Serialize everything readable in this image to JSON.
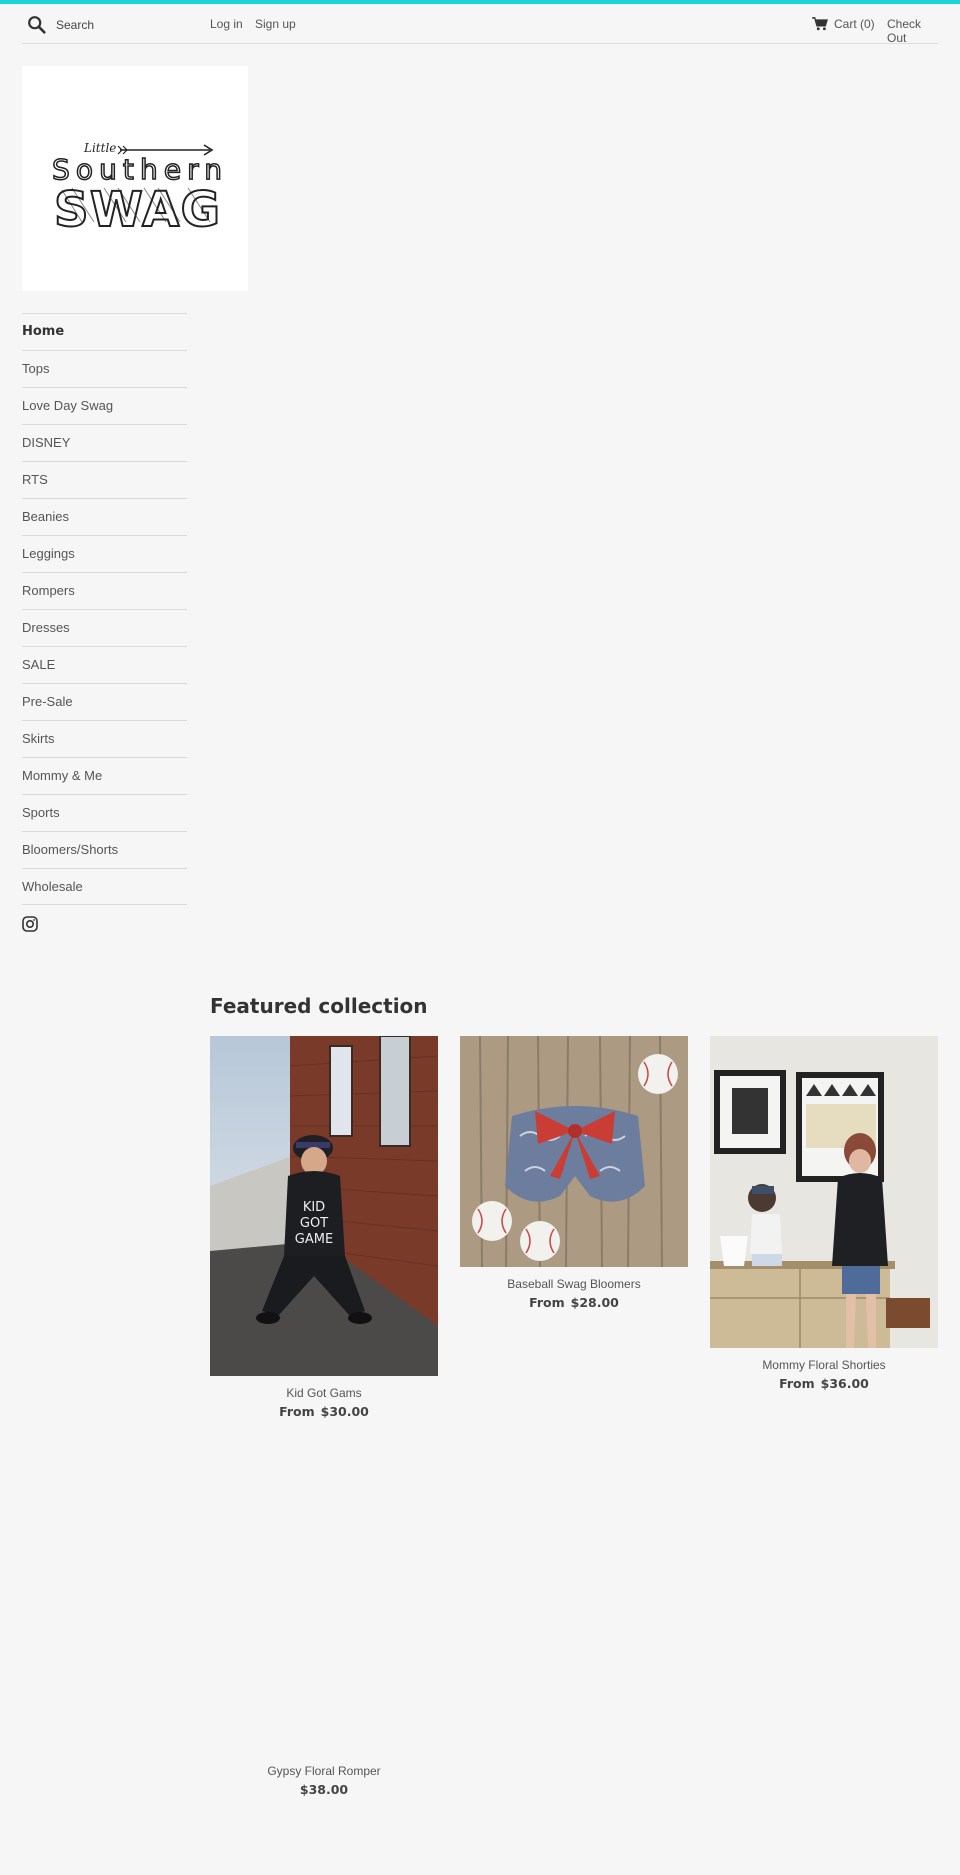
{
  "colors": {
    "accent": "#1cd4d8",
    "background": "#f6f6f6",
    "text": "#333333"
  },
  "header": {
    "search_placeholder": "Search",
    "login_label": "Log in",
    "signup_label": "Sign up",
    "cart_label": "Cart (0)",
    "checkout_label": "Check Out"
  },
  "logo": {
    "line1": "Little",
    "line2": "Southern",
    "line3": "SWAG"
  },
  "nav": {
    "items": [
      {
        "label": "Home"
      },
      {
        "label": "Tops"
      },
      {
        "label": "Love Day Swag"
      },
      {
        "label": "DISNEY"
      },
      {
        "label": "RTS"
      },
      {
        "label": "Beanies"
      },
      {
        "label": "Leggings"
      },
      {
        "label": "Rompers"
      },
      {
        "label": "Dresses"
      },
      {
        "label": "SALE"
      },
      {
        "label": "Pre-Sale"
      },
      {
        "label": "Skirts"
      },
      {
        "label": "Mommy & Me"
      },
      {
        "label": "Sports"
      },
      {
        "label": "Bloomers/Shorts"
      },
      {
        "label": "Wholesale"
      }
    ],
    "social_icon": "instagram-icon"
  },
  "featured": {
    "title": "Featured collection",
    "products": [
      {
        "name": "Kid Got Gams",
        "price_prefix": "From",
        "price": "$30.00",
        "shirt_text": [
          "KID",
          "GOT",
          "GAME"
        ]
      },
      {
        "name": "Baseball Swag Bloomers",
        "price_prefix": "From",
        "price": "$28.00"
      },
      {
        "name": "Mommy Floral Shorties",
        "price_prefix": "From",
        "price": "$36.00"
      },
      {
        "name": "Gypsy Floral Romper",
        "price_prefix": "",
        "price": "$38.00"
      }
    ]
  }
}
